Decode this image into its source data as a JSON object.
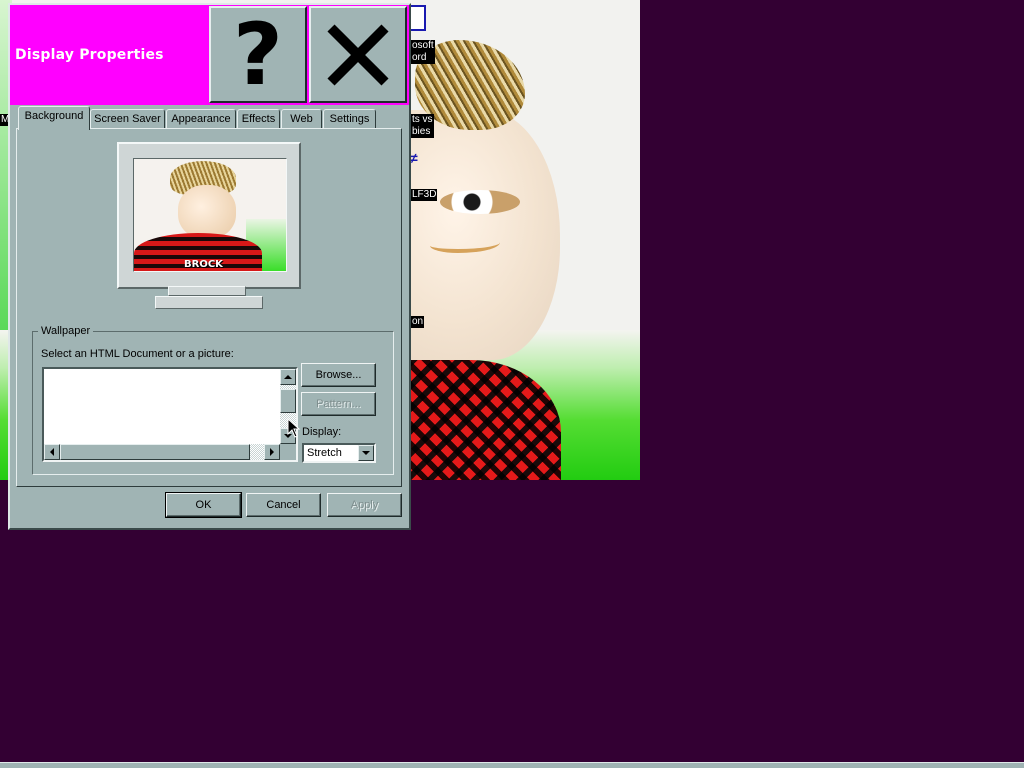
{
  "colors": {
    "desktop_background": "#330033",
    "titlebar": "#ff00ff",
    "dialog_face": "#a0b4b4",
    "title_text": "#ffffff"
  },
  "desktop": {
    "icons": [
      {
        "label": "osoft\nord"
      },
      {
        "label": "ts vs\nbies"
      },
      {
        "label": "LF3D"
      },
      {
        "label": "on"
      },
      {
        "label": "M"
      }
    ]
  },
  "dialog": {
    "title": "Display Properties",
    "help_icon": "question-mark-icon",
    "close_icon": "close-x-icon",
    "tabs": [
      {
        "label": "Background",
        "active": true
      },
      {
        "label": "Screen Saver",
        "active": false
      },
      {
        "label": "Appearance",
        "active": false
      },
      {
        "label": "Effects",
        "active": false
      },
      {
        "label": "Web",
        "active": false
      },
      {
        "label": "Settings",
        "active": false
      }
    ],
    "preview": {
      "label": "BROCK"
    },
    "wallpaper": {
      "group_label": "Wallpaper",
      "instruction": "Select an HTML Document or a picture:",
      "items": [],
      "browse_label": "Browse...",
      "pattern_label": "Pattern...",
      "display_label": "Display:",
      "display_value": "Stretch"
    },
    "buttons": {
      "ok": "OK",
      "cancel": "Cancel",
      "apply": "Apply"
    }
  }
}
